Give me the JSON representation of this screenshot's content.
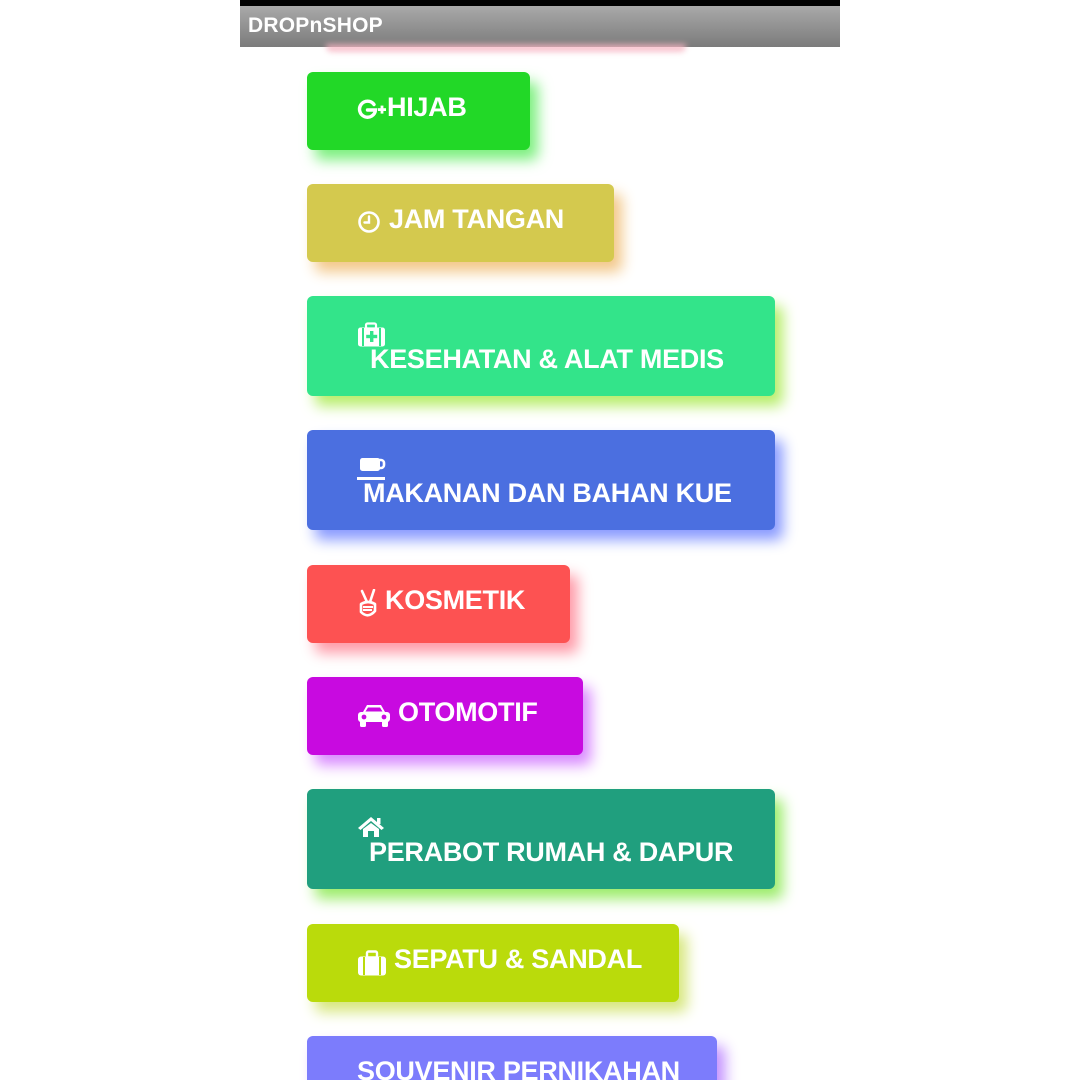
{
  "app": {
    "title": "DROPnSHOP"
  },
  "categories": [
    {
      "label": "HIJAB",
      "icon": "google-plus-icon",
      "color": "#22d827",
      "glow": "#7df07f"
    },
    {
      "label": "JAM TANGAN",
      "icon": "clock-icon",
      "color": "#d4c94e",
      "glow": "#f3c88a"
    },
    {
      "label": "KESEHATAN & ALAT MEDIS",
      "icon": "medkit-icon",
      "color": "#33e48a",
      "glow": "#b7ee6a"
    },
    {
      "label": "MAKANAN DAN BAHAN KUE",
      "icon": "coffee-cup-icon",
      "color": "#4b6fe0",
      "glow": "#8a9bff"
    },
    {
      "label": "KOSMETIK",
      "icon": "victory-hand-icon",
      "color": "#fd5252",
      "glow": "#ff9aa8"
    },
    {
      "label": "OTOMOTIF",
      "icon": "car-icon",
      "color": "#c80ae0",
      "glow": "#d989ff"
    },
    {
      "label": "PERABOT RUMAH & DAPUR",
      "icon": "home-icon",
      "color": "#209f7e",
      "glow": "#9ded6c"
    },
    {
      "label": "SEPATU & SANDAL",
      "icon": "suitcase-icon",
      "color": "#badb0b",
      "glow": "#d7e77e"
    },
    {
      "label": "SOUVENIR PERNIKAHAN",
      "icon": "",
      "color": "#7c7cfc",
      "glow": "#c391ff"
    }
  ]
}
